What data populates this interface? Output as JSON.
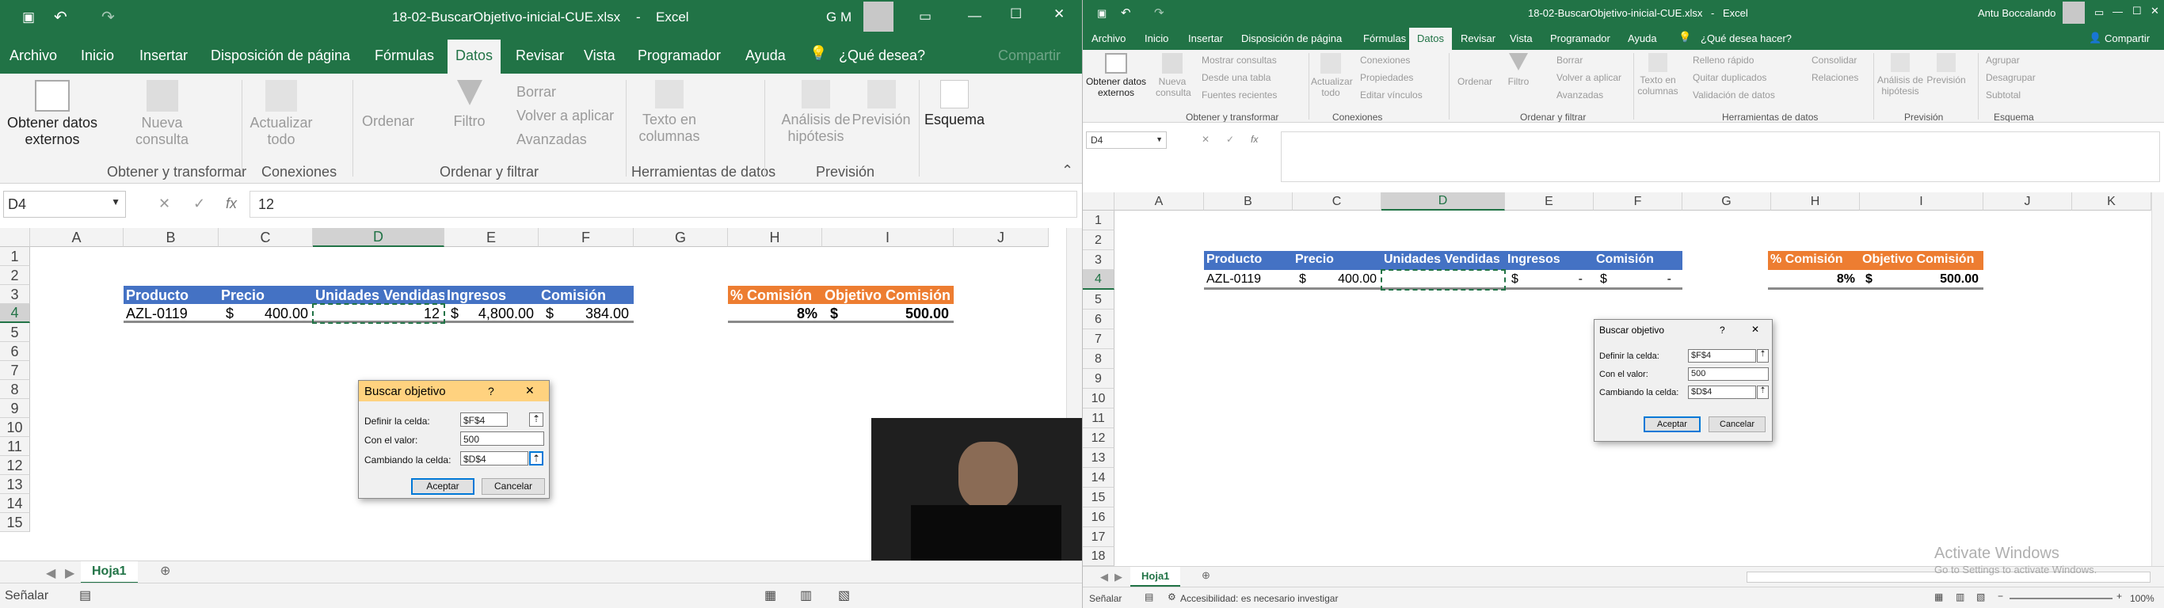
{
  "left": {
    "title_bar": {
      "filename": "18-02-BuscarObjetivo-inicial-CUE.xlsx",
      "sep": "-",
      "app": "Excel",
      "user": "G M"
    },
    "tabs": [
      "Archivo",
      "Inicio",
      "Insertar",
      "Disposición de página",
      "Fórmulas",
      "Datos",
      "Revisar",
      "Vista",
      "Programador",
      "Ayuda"
    ],
    "tell_me": "¿Qué desea?",
    "share": "Compartir",
    "ribbon": {
      "get_external": "Obtener datos externos",
      "new_query": "Nueva consulta",
      "refresh_all": "Actualizar todo",
      "sort": "Ordenar",
      "filter": "Filtro",
      "clear": "Borrar",
      "reapply": "Volver a aplicar",
      "advanced": "Avanzadas",
      "text_to_columns": "Texto en columnas",
      "what_if": "Análisis de hipótesis",
      "forecast": "Previsión",
      "outline": "Esquema",
      "groups": [
        "Obtener y transformar",
        "Conexiones",
        "Ordenar y filtrar",
        "Herramientas de datos",
        "Previsión"
      ]
    },
    "name_box": "D4",
    "formula": "12",
    "columns": [
      "A",
      "B",
      "C",
      "D",
      "E",
      "F",
      "G",
      "H",
      "I",
      "J"
    ],
    "rows": [
      "1",
      "2",
      "3",
      "4",
      "5",
      "6",
      "7",
      "8",
      "9",
      "10",
      "11",
      "12",
      "13",
      "14",
      "15"
    ],
    "table": {
      "headers": [
        "Producto",
        "Precio",
        "Unidades Vendidas",
        "Ingresos",
        "Comisión"
      ],
      "values": {
        "producto": "AZL-0119",
        "precio_sym": "$",
        "precio": "400.00",
        "unidades": "12",
        "ingresos_sym": "$",
        "ingresos": "4,800.00",
        "comision_sym": "$",
        "comision": "384.00"
      },
      "comm_headers": [
        "% Comisión",
        "Objetivo Comisión"
      ],
      "comm_values": {
        "pct": "8%",
        "obj_sym": "$",
        "obj": "500.00"
      }
    },
    "dialog": {
      "title": "Buscar objetivo",
      "help": "?",
      "close": "✕",
      "set_cell_label": "Definir la celda:",
      "set_cell": "$F$4",
      "value_label": "Con el valor:",
      "value": "500",
      "changing_label": "Cambiando la celda:",
      "changing": "$D$4",
      "ok": "Aceptar",
      "cancel": "Cancelar"
    },
    "sheet_tab": "Hoja1",
    "status": "Señalar"
  },
  "right": {
    "title_bar": {
      "filename": "18-02-BuscarObjetivo-inicial-CUE.xlsx",
      "sep": "-",
      "app": "Excel",
      "user": "Antu Boccalando"
    },
    "tabs": [
      "Archivo",
      "Inicio",
      "Insertar",
      "Disposición de página",
      "Fórmulas",
      "Datos",
      "Revisar",
      "Vista",
      "Programador",
      "Ayuda"
    ],
    "tell_me": "¿Qué desea hacer?",
    "share": "Compartir",
    "ribbon": {
      "get_external": "Obtener datos externos",
      "new_query": "Nueva consulta",
      "show_queries": "Mostrar consultas",
      "from_table": "Desde una tabla",
      "recent_sources": "Fuentes recientes",
      "refresh_all": "Actualizar todo",
      "connections": "Conexiones",
      "properties": "Propiedades",
      "edit_links": "Editar vínculos",
      "sort": "Ordenar",
      "filter": "Filtro",
      "clear": "Borrar",
      "reapply": "Volver a aplicar",
      "advanced": "Avanzadas",
      "text_to_columns": "Texto en columnas",
      "flash_fill": "Relleno rápido",
      "remove_dup": "Quitar duplicados",
      "validation": "Validación de datos",
      "consolidate": "Consolidar",
      "relations": "Relaciones",
      "what_if": "Análisis de hipótesis",
      "forecast": "Previsión",
      "group": "Agrupar",
      "ungroup": "Desagrupar",
      "subtotal": "Subtotal",
      "groups": [
        "Obtener y transformar",
        "Conexiones",
        "Ordenar y filtrar",
        "Herramientas de datos",
        "Previsión",
        "Esquema"
      ]
    },
    "name_box": "D4",
    "formula": "",
    "columns": [
      "A",
      "B",
      "C",
      "D",
      "E",
      "F",
      "G",
      "H",
      "I",
      "J",
      "K"
    ],
    "rows": [
      "1",
      "2",
      "3",
      "4",
      "5",
      "6",
      "7",
      "8",
      "9",
      "10",
      "11",
      "12",
      "13",
      "14",
      "15",
      "16",
      "17",
      "18"
    ],
    "table": {
      "headers": [
        "Producto",
        "Precio",
        "Unidades Vendidas",
        "Ingresos",
        "Comisión"
      ],
      "values": {
        "producto": "AZL-0119",
        "precio_sym": "$",
        "precio": "400.00",
        "unidades": "",
        "ingresos_sym": "$",
        "ingresos": "-",
        "comision_sym": "$",
        "comision": "-"
      },
      "comm_headers": [
        "% Comisión",
        "Objetivo Comisión"
      ],
      "comm_values": {
        "pct": "8%",
        "obj_sym": "$",
        "obj": "500.00"
      }
    },
    "dialog": {
      "title": "Buscar objetivo",
      "help": "?",
      "close": "✕",
      "set_cell_label": "Definir la celda:",
      "set_cell": "$F$4",
      "value_label": "Con el valor:",
      "value": "500",
      "changing_label": "Cambiando la celda:",
      "changing": "$D$4",
      "ok": "Aceptar",
      "cancel": "Cancelar"
    },
    "sheet_tab": "Hoja1",
    "status": "Señalar",
    "accessibility": "Accesibilidad: es necesario investigar",
    "zoom": "100%",
    "watermark_title": "Activate Windows",
    "watermark_sub": "Go to Settings to activate Windows."
  },
  "colors": {
    "excel_green": "#217346",
    "table_blue": "#4472c4",
    "table_orange": "#ed7d31"
  }
}
